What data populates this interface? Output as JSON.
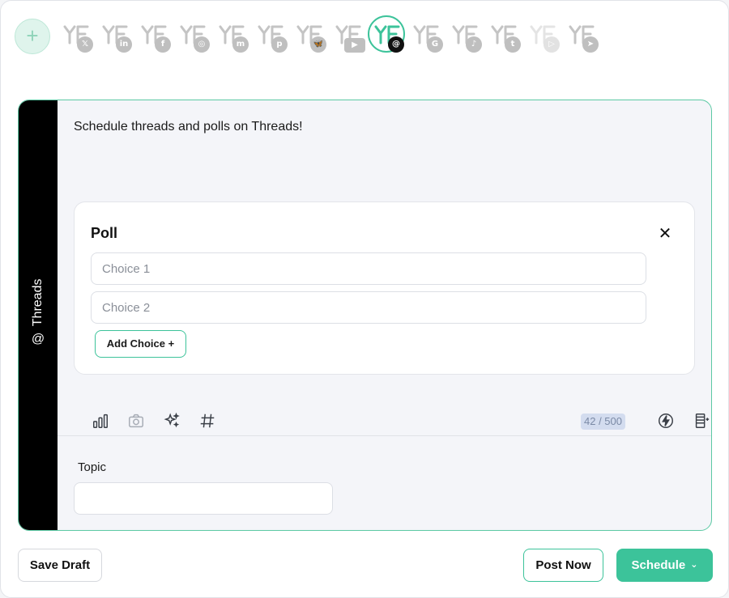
{
  "accounts": {
    "add_label": "+",
    "items": [
      {
        "platform": "x",
        "icon": "x-icon",
        "glyph": "𝕏"
      },
      {
        "platform": "linkedin",
        "icon": "linkedin-icon",
        "glyph": "in"
      },
      {
        "platform": "facebook",
        "icon": "facebook-icon",
        "glyph": "f"
      },
      {
        "platform": "instagram",
        "icon": "instagram-icon",
        "glyph": "◎"
      },
      {
        "platform": "mastodon",
        "icon": "mastodon-icon",
        "glyph": "m"
      },
      {
        "platform": "pinterest",
        "icon": "pinterest-icon",
        "glyph": "p"
      },
      {
        "platform": "bluesky",
        "icon": "bluesky-icon",
        "glyph": "🦋"
      },
      {
        "platform": "youtube",
        "icon": "youtube-icon",
        "glyph": "▶"
      },
      {
        "platform": "threads",
        "icon": "threads-icon",
        "glyph": "@",
        "active": true
      },
      {
        "platform": "google-business",
        "icon": "google-business-icon",
        "glyph": "G"
      },
      {
        "platform": "tiktok",
        "icon": "tiktok-icon",
        "glyph": "♪"
      },
      {
        "platform": "tumblr",
        "icon": "tumblr-icon",
        "glyph": "t"
      },
      {
        "platform": "google-play",
        "icon": "google-play-icon",
        "glyph": "▷"
      },
      {
        "platform": "telegram",
        "icon": "telegram-icon",
        "glyph": "➤"
      }
    ]
  },
  "editor": {
    "platform_label": "Threads",
    "post_text": "Schedule threads and polls on Threads!",
    "poll": {
      "title": "Poll",
      "close_glyph": "✕",
      "choices": [
        {
          "placeholder": "Choice 1"
        },
        {
          "placeholder": "Choice 2"
        }
      ],
      "add_choice_label": "Add Choice  +"
    },
    "counter": "42 / 500",
    "topic": {
      "label": "Topic",
      "value": ""
    }
  },
  "footer": {
    "save_draft": "Save Draft",
    "post_now": "Post Now",
    "schedule": "Schedule"
  },
  "colors": {
    "accent": "#3cc39a",
    "side_strip": "#000000",
    "editor_bg": "#f4f5f9"
  }
}
